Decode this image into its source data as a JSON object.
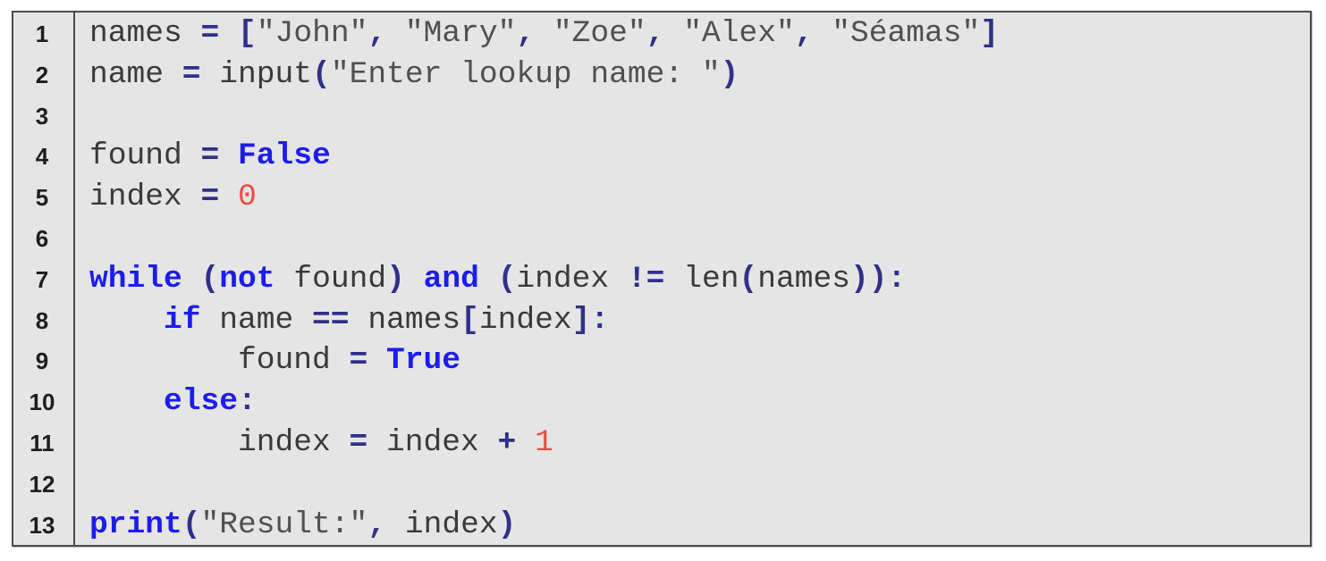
{
  "code_listing": {
    "language": "python",
    "colors": {
      "keyword": "#1c1cf0",
      "operator": "#30308a",
      "string": "#505050",
      "number": "#f04848",
      "identifier": "#3a3a3a",
      "background": "#e5e5e5",
      "border": "#4a4a4a"
    },
    "lines": [
      {
        "number": "1",
        "tokens": [
          {
            "t": "id",
            "v": "names "
          },
          {
            "t": "op",
            "v": "="
          },
          {
            "t": "id",
            "v": " "
          },
          {
            "t": "op",
            "v": "["
          },
          {
            "t": "str",
            "v": "\"John\""
          },
          {
            "t": "op",
            "v": ","
          },
          {
            "t": "id",
            "v": " "
          },
          {
            "t": "str",
            "v": "\"Mary\""
          },
          {
            "t": "op",
            "v": ","
          },
          {
            "t": "id",
            "v": " "
          },
          {
            "t": "str",
            "v": "\"Zoe\""
          },
          {
            "t": "op",
            "v": ","
          },
          {
            "t": "id",
            "v": " "
          },
          {
            "t": "str",
            "v": "\"Alex\""
          },
          {
            "t": "op",
            "v": ","
          },
          {
            "t": "id",
            "v": " "
          },
          {
            "t": "str",
            "v": "\"Séamas\""
          },
          {
            "t": "op",
            "v": "]"
          }
        ]
      },
      {
        "number": "2",
        "tokens": [
          {
            "t": "id",
            "v": "name "
          },
          {
            "t": "op",
            "v": "="
          },
          {
            "t": "id",
            "v": " input"
          },
          {
            "t": "op",
            "v": "("
          },
          {
            "t": "str",
            "v": "\"Enter lookup name: \""
          },
          {
            "t": "op",
            "v": ")"
          }
        ]
      },
      {
        "number": "3",
        "tokens": []
      },
      {
        "number": "4",
        "tokens": [
          {
            "t": "id",
            "v": "found "
          },
          {
            "t": "op",
            "v": "="
          },
          {
            "t": "id",
            "v": " "
          },
          {
            "t": "kw",
            "v": "False"
          }
        ]
      },
      {
        "number": "5",
        "tokens": [
          {
            "t": "id",
            "v": "index "
          },
          {
            "t": "op",
            "v": "="
          },
          {
            "t": "id",
            "v": " "
          },
          {
            "t": "num",
            "v": "0"
          }
        ]
      },
      {
        "number": "6",
        "tokens": []
      },
      {
        "number": "7",
        "tokens": [
          {
            "t": "kw",
            "v": "while"
          },
          {
            "t": "id",
            "v": " "
          },
          {
            "t": "op",
            "v": "("
          },
          {
            "t": "kw",
            "v": "not"
          },
          {
            "t": "id",
            "v": " found"
          },
          {
            "t": "op",
            "v": ")"
          },
          {
            "t": "id",
            "v": " "
          },
          {
            "t": "kw",
            "v": "and"
          },
          {
            "t": "id",
            "v": " "
          },
          {
            "t": "op",
            "v": "("
          },
          {
            "t": "id",
            "v": "index "
          },
          {
            "t": "op",
            "v": "!="
          },
          {
            "t": "id",
            "v": " len"
          },
          {
            "t": "op",
            "v": "("
          },
          {
            "t": "id",
            "v": "names"
          },
          {
            "t": "op",
            "v": "))"
          },
          {
            "t": "op",
            "v": ":"
          }
        ]
      },
      {
        "number": "8",
        "tokens": [
          {
            "t": "id",
            "v": "    "
          },
          {
            "t": "kw",
            "v": "if"
          },
          {
            "t": "id",
            "v": " name "
          },
          {
            "t": "op",
            "v": "=="
          },
          {
            "t": "id",
            "v": " names"
          },
          {
            "t": "op",
            "v": "["
          },
          {
            "t": "id",
            "v": "index"
          },
          {
            "t": "op",
            "v": "]"
          },
          {
            "t": "op",
            "v": ":"
          }
        ]
      },
      {
        "number": "9",
        "tokens": [
          {
            "t": "id",
            "v": "        found "
          },
          {
            "t": "op",
            "v": "="
          },
          {
            "t": "id",
            "v": " "
          },
          {
            "t": "kw",
            "v": "True"
          }
        ]
      },
      {
        "number": "10",
        "tokens": [
          {
            "t": "id",
            "v": "    "
          },
          {
            "t": "kw",
            "v": "else"
          },
          {
            "t": "op",
            "v": ":"
          }
        ]
      },
      {
        "number": "11",
        "tokens": [
          {
            "t": "id",
            "v": "        index "
          },
          {
            "t": "op",
            "v": "="
          },
          {
            "t": "id",
            "v": " index "
          },
          {
            "t": "op",
            "v": "+"
          },
          {
            "t": "id",
            "v": " "
          },
          {
            "t": "num",
            "v": "1"
          }
        ]
      },
      {
        "number": "12",
        "tokens": []
      },
      {
        "number": "13",
        "tokens": [
          {
            "t": "kw",
            "v": "print"
          },
          {
            "t": "op",
            "v": "("
          },
          {
            "t": "str",
            "v": "\"Result:\""
          },
          {
            "t": "op",
            "v": ","
          },
          {
            "t": "id",
            "v": " index"
          },
          {
            "t": "op",
            "v": ")"
          }
        ]
      }
    ]
  }
}
